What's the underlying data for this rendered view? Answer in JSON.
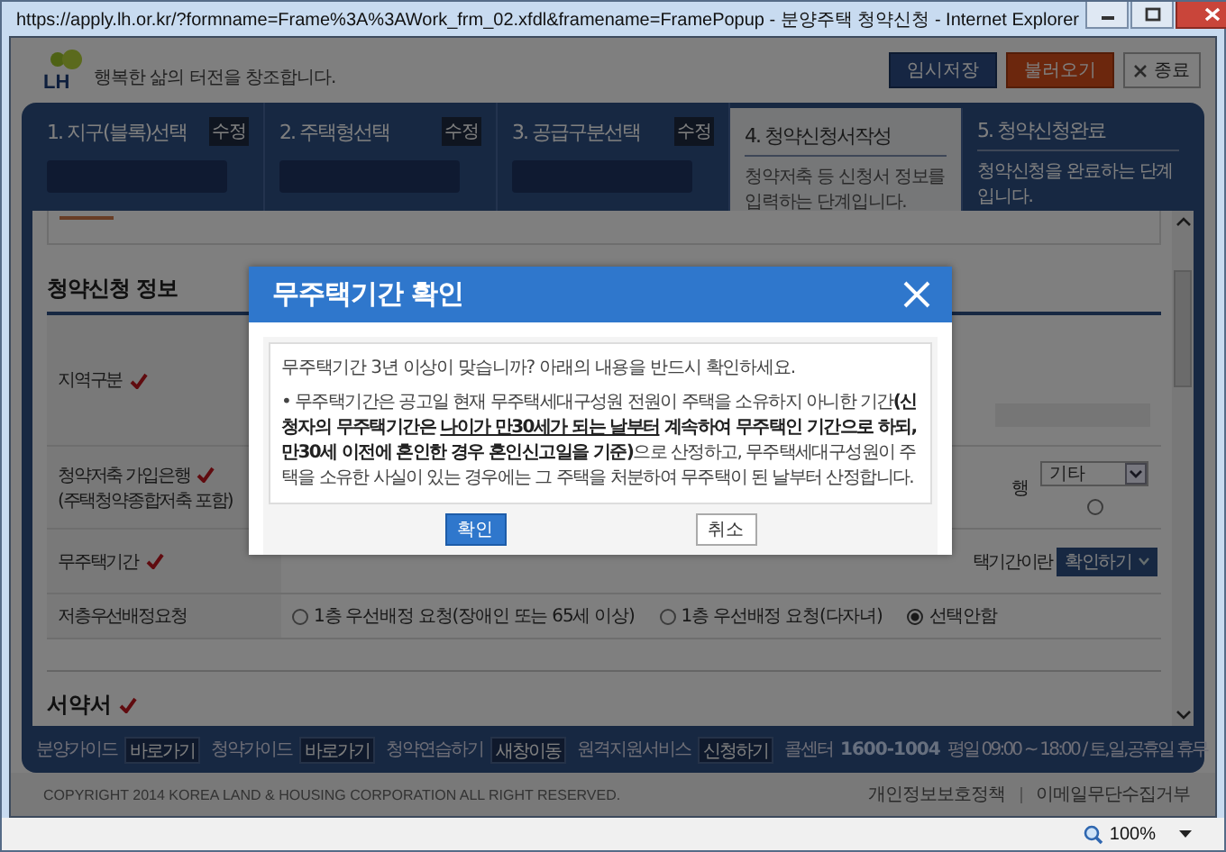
{
  "window": {
    "title": "https://apply.lh.or.kr/?formname=Frame%3A%3AWork_frm_02.xfdl&framename=FramePopup - 분양주택 청약신청 - Internet Explorer"
  },
  "header": {
    "logo": "LH",
    "slogan": "행복한 삶의 터전을 창조합니다.",
    "buttons": [
      {
        "label": "임시저장",
        "kind": "primary"
      },
      {
        "label": "불러오기",
        "kind": "accent"
      },
      {
        "label": "종료",
        "kind": "close"
      }
    ]
  },
  "steps": [
    {
      "label": "1. 지구(블록)선택",
      "badge": "수정",
      "redacted": true,
      "selected": false
    },
    {
      "label": "2. 주택형선택",
      "badge": "수정",
      "redacted": true,
      "selected": false
    },
    {
      "label": "3. 공급구분선택",
      "badge": "수정",
      "redacted": true,
      "selected": false
    },
    {
      "label": "4. 청약신청서작성",
      "description": "청약저축 등 신청서 정보를 입력하는 단계입니다.",
      "selected": true
    },
    {
      "label": "5. 청약신청완료",
      "description": "청약신청을 완료하는 단계입니다.",
      "selected": false
    }
  ],
  "form": {
    "section_title": "청약신청 정보",
    "rows": [
      {
        "kind": "field",
        "label": "지역구분",
        "required": true
      },
      {
        "kind": "bank",
        "label": "청약저축 가입은행",
        "sublabel": "(주택청약종합저축 포함)",
        "required": true,
        "fragment": "행",
        "select": "기타",
        "radio": {
          "selected": false
        }
      },
      {
        "kind": "period",
        "label": "무주택기간",
        "required": true,
        "fragment": "택기간이란",
        "button": "확인하기"
      },
      {
        "kind": "radios",
        "label": "저층우선배정요청",
        "required": false,
        "options": [
          {
            "label": "1층 우선배정 요청(장애인 또는 65세 이상)",
            "selected": false
          },
          {
            "label": "1층 우선배정 요청(다자녀)",
            "selected": false
          },
          {
            "label": "선택안함",
            "selected": true
          }
        ]
      }
    ],
    "next_section": {
      "title": "서약서",
      "required": true
    }
  },
  "footer": {
    "links": [
      {
        "label": "분양가이드",
        "action": "바로가기"
      },
      {
        "label": "청약가이드",
        "action": "바로가기"
      },
      {
        "label": "청약연습하기",
        "action": "새창이동"
      },
      {
        "label": "원격지원서비스",
        "action": "신청하기"
      }
    ],
    "call_center": {
      "label": "콜센터",
      "number": "1600-1004",
      "hours": "평일 09:00 ~ 18:00 / 토,일,공휴일 휴무"
    }
  },
  "copyright": {
    "text": "COPYRIGHT 2014 KOREA LAND & HOUSING CORPORATION ALL RIGHT RESERVED.",
    "links": [
      "개인정보보호정책",
      "이메일무단수집거부"
    ]
  },
  "dialog": {
    "title": "무주택기간 확인",
    "question": "무주택기간 3년 이상이 맞습니까? 아래의 내용을 반드시 확인하세요.",
    "paragraph": [
      {
        "text": "• 무주택기간은 공고일 현재 무주택세대구성원 전원이 주택을 소유하지 아니한 기간",
        "kind": "plain"
      },
      {
        "text": "(신청자의 무주택기간은 ",
        "kind": "strong"
      },
      {
        "text": "나이가 만30세가 되는 날부터",
        "kind": "key"
      },
      {
        "text": " 계속하여 무주택인 기간으로 하되, 만30세 이전에 혼인한 경우 혼인신고일을 기준)",
        "kind": "strong"
      },
      {
        "text": "으로 산정하고, 무주택세대구성원이 주택을 소유한 사실이 있는 경우에는 그 주택을 처분하여 무주택이 된 날부터 산정합니다.",
        "kind": "plain"
      }
    ],
    "buttons": [
      {
        "label": "확인",
        "kind": "primary"
      },
      {
        "label": "취소",
        "kind": "secondary"
      }
    ]
  },
  "status_bar": {
    "zoom": "100%"
  }
}
